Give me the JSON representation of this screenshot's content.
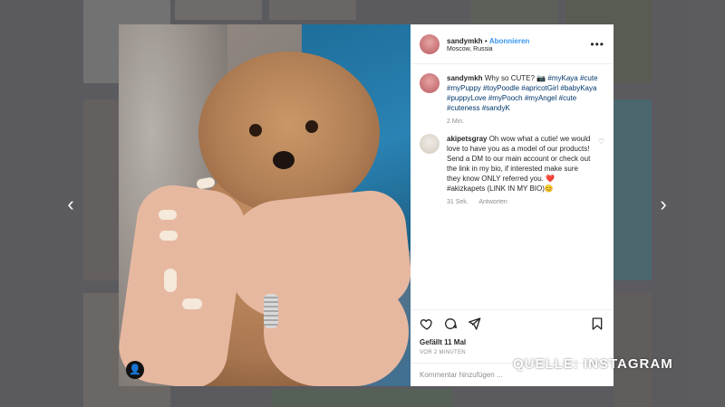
{
  "post": {
    "username": "sandymkh",
    "follow_label": "Abonnieren",
    "location": "Moscow, Russia",
    "caption": {
      "username": "sandymkh",
      "text_start": "Why so CUTE?",
      "emoji": "📷",
      "hashtags": "#myKaya #cute #myPuppy #toyPoodle #apricotGirl #babyKaya #puppyLove #myPooch #myAngel #cute #cuteness #sandyK",
      "time": "2 Min."
    },
    "comment": {
      "username": "akipetsgray",
      "text": "Oh wow what a cutie! we would love to have you as a model of our products! Send a DM to our main account or check out the link in my bio, if interested make sure they know ONLY referred you. ❤️#akizkapets (LINK IN MY BIO)😊",
      "time": "31 Sek.",
      "reply_label": "Antworten"
    },
    "likes": "Gefällt 11 Mal",
    "timestamp": "VOR 2 MINUTEN",
    "add_comment_placeholder": "Kommentar hinzufügen ..."
  },
  "watermark": "QUELLE: INSTAGRAM",
  "icons": {
    "more": "more-icon",
    "heart": "heart-icon",
    "comment": "comment-icon",
    "share": "share-icon",
    "bookmark": "bookmark-icon",
    "prev": "chevron-left-icon",
    "next": "chevron-right-icon",
    "user_tag": "user-tag-icon"
  },
  "colors": {
    "link": "#3897f0",
    "hashtag": "#00376b",
    "muted": "#8e8e8e"
  }
}
